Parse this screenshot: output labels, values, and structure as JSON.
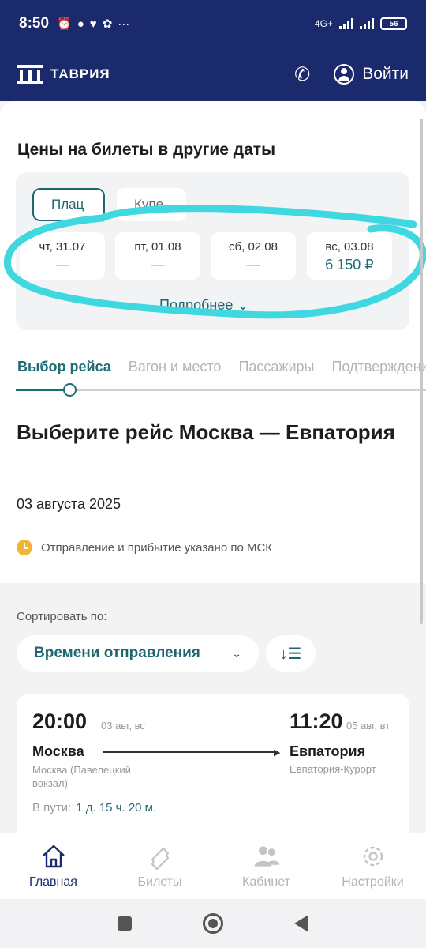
{
  "status": {
    "time": "8:50",
    "network": "4G+",
    "battery": "56"
  },
  "header": {
    "brand": "ТАВРИЯ",
    "login_label": "Войти"
  },
  "prices": {
    "title": "Цены на билеты в другие даты",
    "classes": [
      "Плац",
      "Купе"
    ],
    "dates": [
      {
        "day": "чт, 31.07",
        "price": "—"
      },
      {
        "day": "пт, 01.08",
        "price": "—"
      },
      {
        "day": "сб, 02.08",
        "price": "—"
      },
      {
        "day": "вс, 03.08",
        "price": "6 150 ₽"
      }
    ],
    "more_label": "Подробнее",
    "annotation_color": "#3fd7e0"
  },
  "steps": [
    "Выбор рейса",
    "Вагон и место",
    "Пассажиры",
    "Подтверждение"
  ],
  "route": {
    "title": "Выберите рейс Москва — Евпатория",
    "date": "03 августа 2025",
    "tz_note": "Отправление и прибытие указано по МСК"
  },
  "sort": {
    "label": "Сортировать по:",
    "value": "Времени отправления"
  },
  "trip": {
    "dep_time": "20:00",
    "dep_date": "03 авг, вс",
    "arr_time": "11:20",
    "arr_date": "05 авг, вт",
    "from": "Москва",
    "to": "Евпатория",
    "from_station": "Москва (Павелецкий вокзал)",
    "to_station": "Евпатория-Курорт",
    "duration_label": "В пути:",
    "duration": "1 д. 15 ч. 20 м."
  },
  "nav": [
    {
      "label": "Главная",
      "icon": "home-icon"
    },
    {
      "label": "Билеты",
      "icon": "ticket-icon"
    },
    {
      "label": "Кабинет",
      "icon": "users-icon"
    },
    {
      "label": "Настройки",
      "icon": "gear-icon"
    }
  ],
  "colors": {
    "brand": "#1b2a6d",
    "accent": "#1f6d74"
  }
}
